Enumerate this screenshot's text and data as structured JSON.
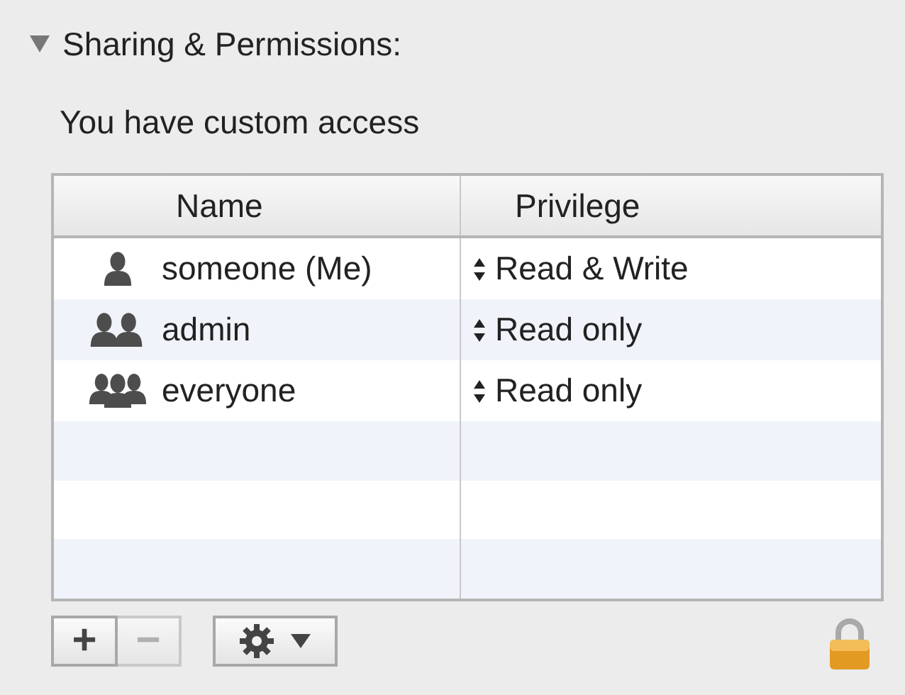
{
  "section": {
    "title": "Sharing & Permissions:",
    "expanded": true
  },
  "access_summary": "You have custom access",
  "table": {
    "columns": [
      "Name",
      "Privilege"
    ],
    "rows": [
      {
        "kind": "user",
        "name": "someone (Me)",
        "privilege": "Read & Write"
      },
      {
        "kind": "group",
        "name": "admin",
        "privilege": "Read only"
      },
      {
        "kind": "everyone",
        "name": "everyone",
        "privilege": "Read only"
      }
    ]
  },
  "toolbar": {
    "add": {
      "label": "+",
      "disabled": false
    },
    "remove": {
      "label": "−",
      "disabled": true
    },
    "locked": true
  }
}
